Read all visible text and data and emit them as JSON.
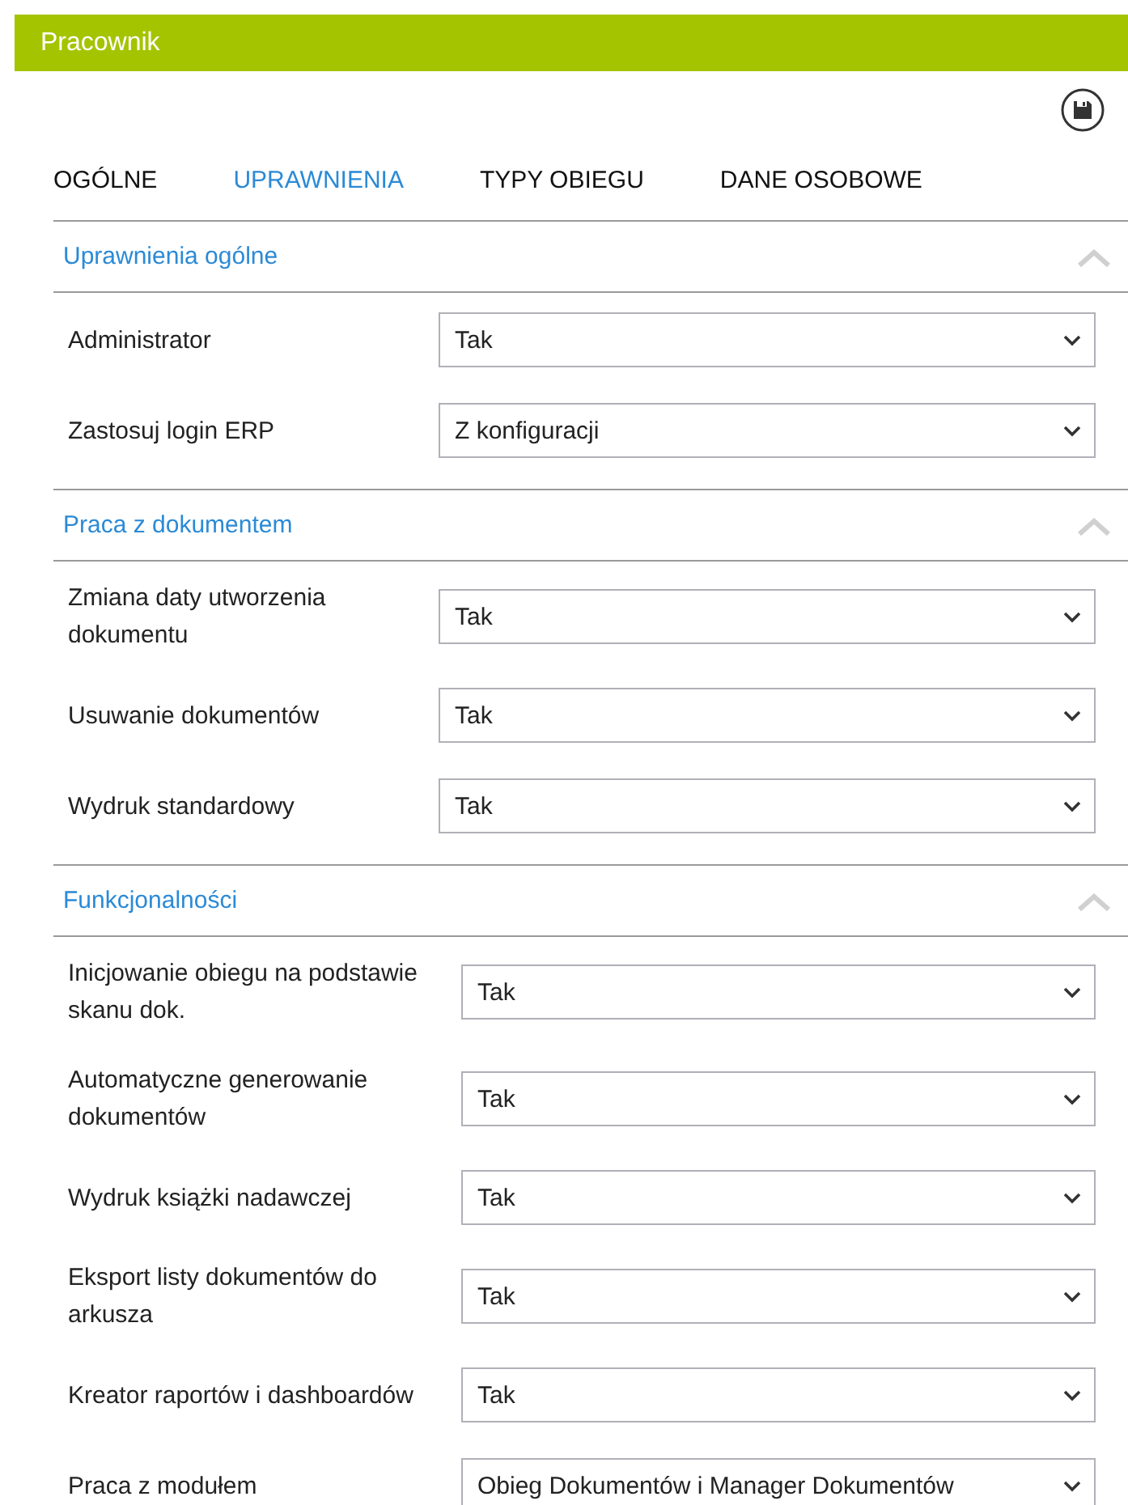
{
  "window": {
    "title": "Pracownik"
  },
  "tabs": [
    {
      "label": "OGÓLNE",
      "selected": false
    },
    {
      "label": "UPRAWNIENIA",
      "selected": true
    },
    {
      "label": "TYPY OBIEGU",
      "selected": false
    },
    {
      "label": "DANE OSOBOWE",
      "selected": false
    }
  ],
  "sections": [
    {
      "title": "Uprawnienia ogólne",
      "expanded": true,
      "fields": [
        {
          "label": "Administrator",
          "value": "Tak"
        },
        {
          "label": "Zastosuj login ERP",
          "value": "Z konfiguracji"
        }
      ]
    },
    {
      "title": "Praca z dokumentem",
      "expanded": true,
      "fields": [
        {
          "label": "Zmiana daty utworzenia dokumentu",
          "value": "Tak"
        },
        {
          "label": "Usuwanie dokumentów",
          "value": "Tak"
        },
        {
          "label": "Wydruk standardowy",
          "value": "Tak"
        }
      ]
    },
    {
      "title": "Funkcjonalności",
      "expanded": true,
      "fields": [
        {
          "label": "Inicjowanie obiegu na podstawie skanu dok.",
          "value": "Tak"
        },
        {
          "label": "Automatyczne generowanie dokumentów",
          "value": "Tak"
        },
        {
          "label": "Wydruk książki nadawczej",
          "value": "Tak"
        },
        {
          "label": "Eksport listy dokumentów do arkusza",
          "value": "Tak"
        },
        {
          "label": "Kreator raportów i dashboardów",
          "value": "Tak"
        },
        {
          "label": "Praca z modułem",
          "value": "Obieg Dokumentów i Manager Dokumentów"
        }
      ]
    }
  ]
}
